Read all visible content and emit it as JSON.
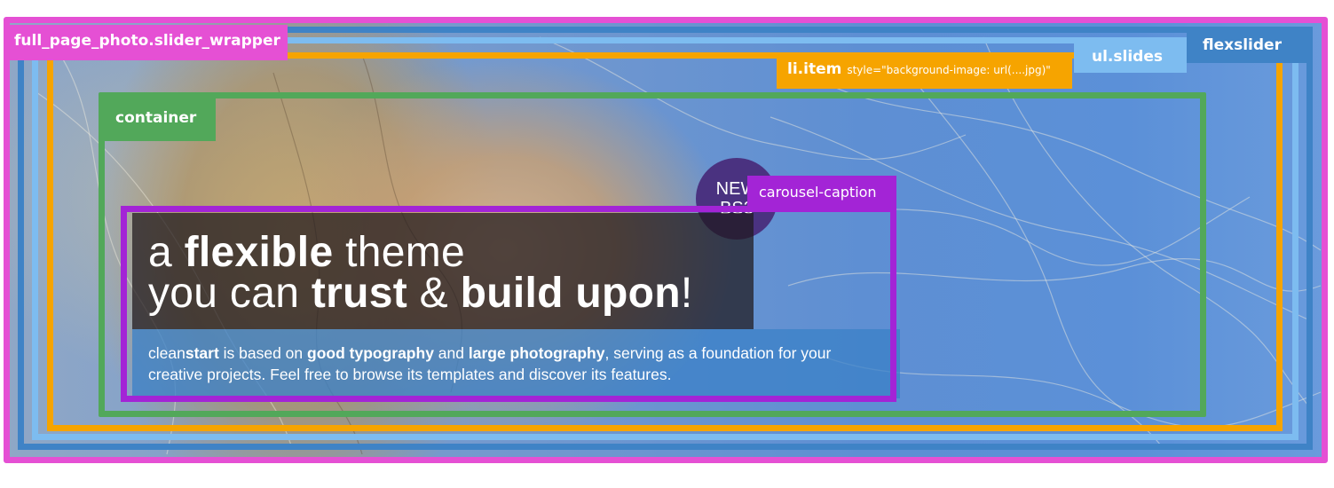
{
  "labels": {
    "slider_wrapper": "full_page_photo.slider_wrapper",
    "flexslider": "flexslider",
    "slides": "ul.slides",
    "item": "li.item",
    "item_attr": "style=\"background-image: url(....jpg)\"",
    "container": "container",
    "caption": "carousel-caption"
  },
  "badge": {
    "line1": "NEW",
    "line2": "BS3"
  },
  "headline": {
    "line1": {
      "a": "a ",
      "b": "flexible",
      "c": " theme"
    },
    "line2": {
      "a": "you can ",
      "b": "trust",
      "c": " & ",
      "d": "build upon",
      "e": "!"
    }
  },
  "description": {
    "p1": "clean",
    "p2": "start",
    "p3": " is based on ",
    "p4": "good typography",
    "p5": " and ",
    "p6": "large photography",
    "p7": ", serving as a foundation for your",
    "p8": "creative projects. Feel free to browse its templates and discover its features."
  },
  "colors": {
    "slider_wrapper": "#e550d4",
    "flexslider": "#3f83c6",
    "slides": "#7dbcf0",
    "item": "#f6a400",
    "container": "#52a85a",
    "caption": "#a324d6",
    "badge": "#4a3280"
  }
}
